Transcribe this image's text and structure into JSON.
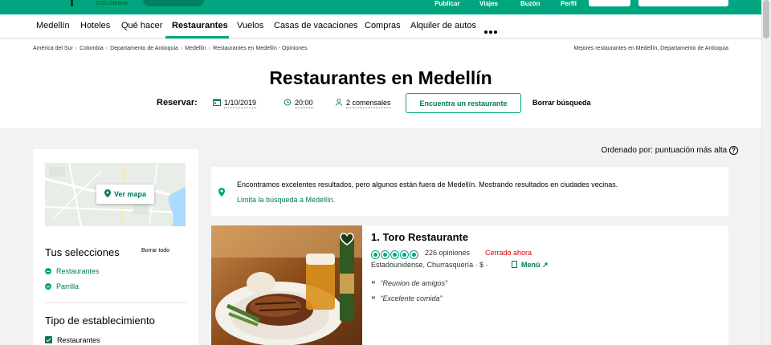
{
  "topbar": {
    "country": "COLOMBIA",
    "links": [
      "Publicar",
      "Viajes",
      "Buzón",
      "Perfil"
    ]
  },
  "nav": {
    "items": [
      "Medellín",
      "Hoteles",
      "Qué hacer",
      "Restaurantes",
      "Vuelos",
      "Casas de vacaciones",
      "Compras",
      "Alquiler de autos"
    ],
    "more_icon": "more-dots-icon"
  },
  "breadcrumb": {
    "items": [
      "América del Sur",
      "Colombia",
      "Departamento de Antioquia",
      "Medellín",
      "Restaurantes en Medellín - Opiniones"
    ],
    "right": "Mejores restaurantes en Medellín, Departamento de Antioquia"
  },
  "header": {
    "title": "Restaurantes en Medellín",
    "reserve_label": "Reservar:",
    "date": "1/10/2019",
    "time": "20:00",
    "guests": "2 comensales",
    "find_button": "Encuentra un restaurante",
    "clear_button": "Borrar búsqueda"
  },
  "sidebar": {
    "map_button": "Ver mapa",
    "selections_title": "Tus selecciones",
    "selections_clear": "Borrar todo",
    "selections": [
      "Restaurantes",
      "Parrilla"
    ],
    "type_title": "Tipo de establecimiento",
    "type_items": [
      "Restaurantes"
    ]
  },
  "sort": {
    "label": "Ordenado por: puntuación más alta",
    "help": "?"
  },
  "notice": {
    "message": "Encontramos excelentes resultados, pero algunos están fuera de Medellín. Mostrando resultados en ciudades vecinas.",
    "link": "Limita la búsqueda a Medellín."
  },
  "results": [
    {
      "name": "1. Toro Restaurante",
      "rating": 5,
      "reviews": "226 opiniones",
      "status": "Cerrado ahora",
      "cuisine": "Estadounidense, Churrasquería",
      "price": "$",
      "menu": "Menú ↗",
      "quotes": [
        "“Reunion de amigos”",
        "“Excelente comida”"
      ],
      "quote_mark": "”"
    }
  ],
  "colors": {
    "brand": "#00a680",
    "brand_dark": "#00785b",
    "closed": "#d80007"
  }
}
